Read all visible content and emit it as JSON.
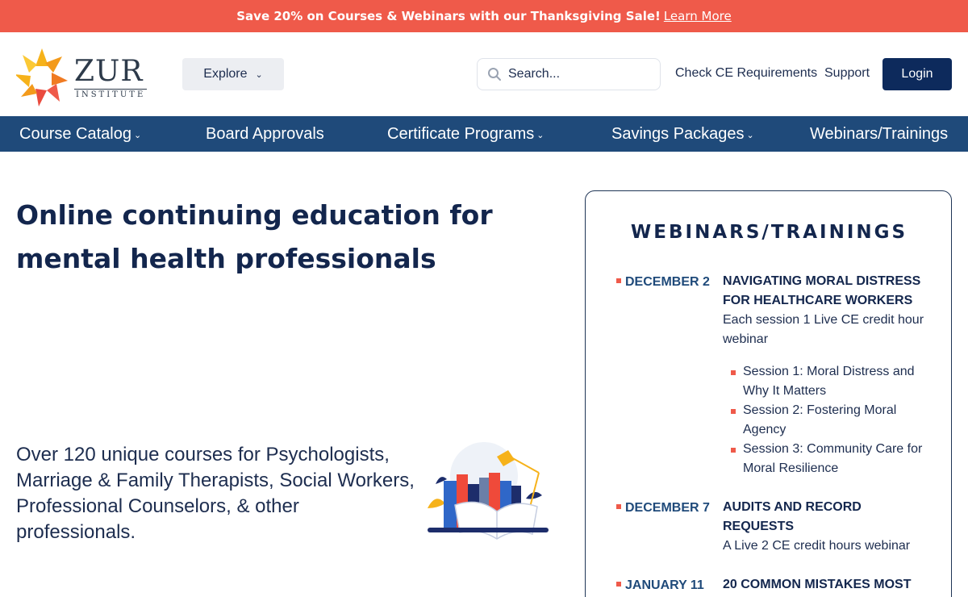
{
  "promo": {
    "text": "Save 20% on Courses & Webinars with our Thanksgiving Sale!",
    "link": "Learn More",
    "bg": "#ef5a4a"
  },
  "header": {
    "logo_wordmark": "ZUR",
    "logo_sub": "INSTITUTE",
    "explore_label": "Explore",
    "search_placeholder": "Search...",
    "links": [
      "Check CE Requirements",
      "Support"
    ],
    "login_label": "Login"
  },
  "nav": {
    "items": [
      {
        "label": "Course Catalog",
        "dropdown": true
      },
      {
        "label": "Board Approvals",
        "dropdown": false
      },
      {
        "label": "Certificate Programs",
        "dropdown": true
      },
      {
        "label": "Savings Packages",
        "dropdown": true
      },
      {
        "label": "Webinars/Trainings",
        "dropdown": false
      }
    ],
    "bg": "#1f4a7a"
  },
  "hero": {
    "title": "Online continuing education for mental health professionals",
    "subtitle": "Over 120 unique courses for Psychologists, Marriage & Family Therapists, Social Workers, Professional Counselors, & other professionals."
  },
  "webinars": {
    "title": "WEBINARS/TRAININGS",
    "events": [
      {
        "date": "DECEMBER 2",
        "title": "Navigating Moral Distress for Healthcare Workers",
        "desc": "Each session 1 Live CE credit hour webinar",
        "sessions": [
          "Session 1: Moral Distress and Why It Matters",
          "Session 2: Fostering Moral Agency",
          "Session 3: Community Care for Moral Resilience"
        ]
      },
      {
        "date": "DECEMBER 7",
        "title": "Audits and Record Requests",
        "desc": "A Live 2 CE credit hours webinar"
      },
      {
        "date": "JANUARY 11",
        "title": "20 Common Mistakes Most"
      }
    ]
  }
}
